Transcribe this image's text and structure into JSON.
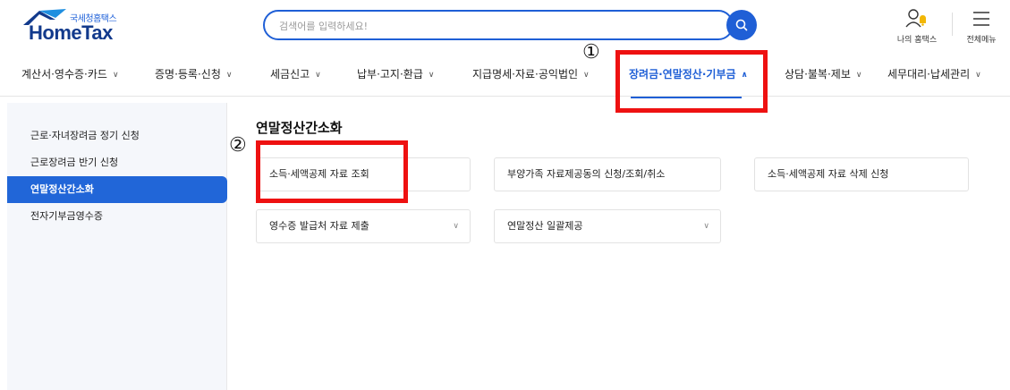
{
  "header": {
    "logo_small": "국세청홈택스",
    "logo_main": "HomeTax",
    "search_placeholder": "검색어를 입력하세요!",
    "my_hometax_label": "나의 홈택스",
    "all_menu_label": "전체메뉴"
  },
  "nav": {
    "items": [
      {
        "label": "계산서·영수증·카드"
      },
      {
        "label": "증명·등록·신청"
      },
      {
        "label": "세금신고"
      },
      {
        "label": "납부·고지·환급"
      },
      {
        "label": "지급명세·자료·공익법인"
      },
      {
        "label": "장려금·연말정산·기부금",
        "active": true
      },
      {
        "label": "상담·불복·제보"
      },
      {
        "label": "세무대리·납세관리"
      }
    ]
  },
  "sidebar": {
    "items": [
      {
        "label": "근로·자녀장려금 정기 신청"
      },
      {
        "label": "근로장려금 반기 신청"
      },
      {
        "label": "연말정산간소화",
        "active": true
      },
      {
        "label": "전자기부금영수증"
      }
    ]
  },
  "main": {
    "title": "연말정산간소화",
    "cards": [
      {
        "label": "소득·세액공제 자료 조회"
      },
      {
        "label": "부양가족 자료제공동의 신청/조회/취소"
      },
      {
        "label": "소득·세액공제 자료 삭제 신청"
      },
      {
        "label": "영수증 발급처 자료 제출"
      },
      {
        "label": "연말정산 일괄제공"
      }
    ]
  },
  "annotations": {
    "one": "①",
    "two": "②",
    "color": "#ee1111"
  },
  "colors": {
    "brand": "#1f5fd6",
    "active_sidebar": "#2166d8"
  }
}
